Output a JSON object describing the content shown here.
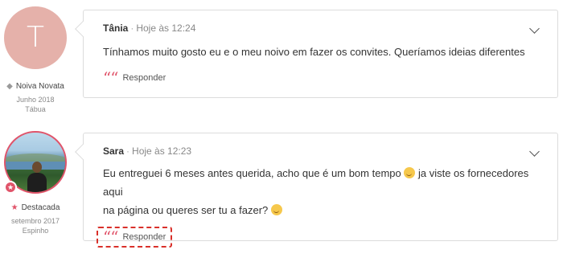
{
  "comments": [
    {
      "author": "Tânia",
      "time": "Hoje às 12:24",
      "text": "Tínhamos muito gosto eu e o meu noivo em fazer os convites. Queríamos ideias diferentes",
      "reply_label": "Responder",
      "profile": {
        "avatar_letter": "T",
        "avatar_color": "#e5b1aa",
        "rank": "Noiva Novata",
        "rank_icon": "diamond-icon",
        "date": "Junho 2018",
        "location": "Tábua"
      }
    },
    {
      "author": "Sara",
      "time": "Hoje às 12:23",
      "text_part1": "Eu entreguei 6 meses antes querida, acho que é um bom tempo",
      "text_part2": "ja viste os fornecedores aqui",
      "text_part3": "na página ou queres ser tu a fazer?",
      "reply_label": "Responder",
      "profile": {
        "rank": "Destacada",
        "rank_icon": "star-icon",
        "date": "setembro 2017",
        "location": "Espinho"
      }
    }
  ],
  "colors": {
    "accent": "#e0546a",
    "border": "#dcdcdc",
    "highlight": "#d9302a"
  }
}
